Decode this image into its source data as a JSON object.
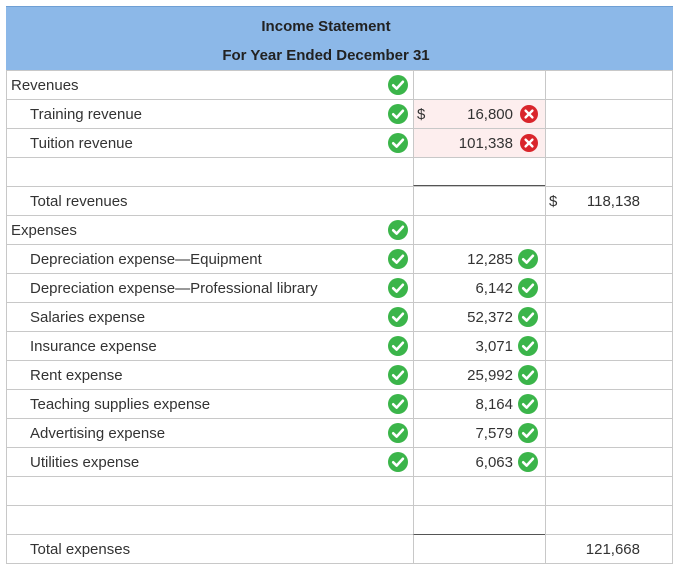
{
  "header": {
    "title": "Income Statement",
    "subtitle": "For Year Ended December 31"
  },
  "rows": [
    {
      "label": "Revenues",
      "indent": false,
      "check": true,
      "dollar1": "",
      "value1": "",
      "value1_status": "",
      "dollar2": "",
      "value2": ""
    },
    {
      "label": "Training revenue",
      "indent": true,
      "check": true,
      "dollar1": "$",
      "value1": "16,800",
      "value1_status": "incorrect",
      "dollar2": "",
      "value2": ""
    },
    {
      "label": "Tuition revenue",
      "indent": true,
      "check": true,
      "dollar1": "",
      "value1": "101,338",
      "value1_status": "incorrect",
      "dollar2": "",
      "value2": ""
    },
    {
      "label": "",
      "indent": false,
      "check": false,
      "dollar1": "",
      "value1": "",
      "value1_status": "",
      "dollar2": "",
      "value2": ""
    },
    {
      "label": "Total revenues",
      "indent": true,
      "check": false,
      "dollar1": "",
      "value1": "",
      "value1_status": "",
      "dollar2": "$",
      "value2": "118,138"
    },
    {
      "label": "Expenses",
      "indent": false,
      "check": true,
      "dollar1": "",
      "value1": "",
      "value1_status": "",
      "dollar2": "",
      "value2": ""
    },
    {
      "label": "Depreciation expense—Equipment",
      "indent": true,
      "check": true,
      "dollar1": "",
      "value1": "12,285",
      "value1_status": "correct",
      "dollar2": "",
      "value2": ""
    },
    {
      "label": "Depreciation expense—Professional library",
      "indent": true,
      "check": true,
      "dollar1": "",
      "value1": "6,142",
      "value1_status": "correct",
      "dollar2": "",
      "value2": ""
    },
    {
      "label": "Salaries expense",
      "indent": true,
      "check": true,
      "dollar1": "",
      "value1": "52,372",
      "value1_status": "correct",
      "dollar2": "",
      "value2": ""
    },
    {
      "label": "Insurance expense",
      "indent": true,
      "check": true,
      "dollar1": "",
      "value1": "3,071",
      "value1_status": "correct",
      "dollar2": "",
      "value2": ""
    },
    {
      "label": "Rent expense",
      "indent": true,
      "check": true,
      "dollar1": "",
      "value1": "25,992",
      "value1_status": "correct",
      "dollar2": "",
      "value2": ""
    },
    {
      "label": "Teaching supplies expense",
      "indent": true,
      "check": true,
      "dollar1": "",
      "value1": "8,164",
      "value1_status": "correct",
      "dollar2": "",
      "value2": ""
    },
    {
      "label": "Advertising expense",
      "indent": true,
      "check": true,
      "dollar1": "",
      "value1": "7,579",
      "value1_status": "correct",
      "dollar2": "",
      "value2": ""
    },
    {
      "label": "Utilities expense",
      "indent": true,
      "check": true,
      "dollar1": "",
      "value1": "6,063",
      "value1_status": "correct",
      "dollar2": "",
      "value2": ""
    },
    {
      "label": "",
      "indent": false,
      "check": false,
      "dollar1": "",
      "value1": "",
      "value1_status": "",
      "dollar2": "",
      "value2": ""
    },
    {
      "label": "",
      "indent": false,
      "check": false,
      "dollar1": "",
      "value1": "",
      "value1_status": "",
      "dollar2": "",
      "value2": ""
    },
    {
      "label": "Total expenses",
      "indent": true,
      "check": false,
      "dollar1": "",
      "value1": "",
      "value1_status": "",
      "dollar2": "",
      "value2": "121,668"
    }
  ],
  "colors": {
    "header_bg": "#8cb8e8",
    "correct": "#3bb54a",
    "incorrect": "#d9252b",
    "grid": "#c8c8c8",
    "error_cell_bg": "#fdeeee"
  },
  "icons": {
    "correct": "check-circle-icon",
    "incorrect": "x-circle-icon"
  }
}
